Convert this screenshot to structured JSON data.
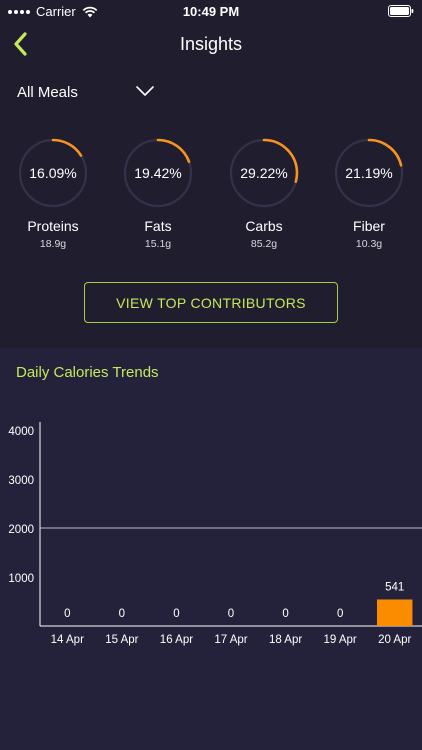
{
  "status": {
    "carrier": "Carrier",
    "time": "10:49 PM"
  },
  "nav": {
    "title": "Insights",
    "back_icon": "chevron-left-icon"
  },
  "filter": {
    "selected": "All Meals"
  },
  "macros": [
    {
      "name": "Proteins",
      "percent_label": "16.09%",
      "percent": 16.09,
      "grams": "18.9g"
    },
    {
      "name": "Fats",
      "percent_label": "19.42%",
      "percent": 19.42,
      "grams": "15.1g"
    },
    {
      "name": "Carbs",
      "percent_label": "29.22%",
      "percent": 29.22,
      "grams": "85.2g"
    },
    {
      "name": "Fiber",
      "percent_label": "21.19%",
      "percent": 21.19,
      "grams": "10.3g"
    }
  ],
  "contributors_button": "VIEW TOP CONTRIBUTORS",
  "colors": {
    "accent_green": "#c6e85a",
    "ring_orange": "#f7931e",
    "bar_orange": "#fb8c00",
    "ring_track": "#34324a"
  },
  "chart_data": {
    "type": "bar",
    "title": "Daily Calories Trends",
    "categories": [
      "14 Apr",
      "15 Apr",
      "16 Apr",
      "17 Apr",
      "18 Apr",
      "19 Apr",
      "20 Apr"
    ],
    "values": [
      0,
      0,
      0,
      0,
      0,
      0,
      541
    ],
    "y_ticks": [
      1000,
      2000,
      3000,
      4000
    ],
    "ylim": [
      0,
      4000
    ],
    "reference_line": 2000,
    "xlabel": "",
    "ylabel": ""
  }
}
